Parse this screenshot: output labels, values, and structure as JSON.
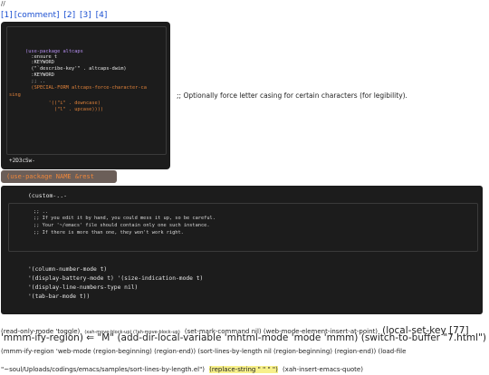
{
  "page": {
    "top_slashes": "//",
    "footnotes": [
      "[1]",
      "[comment]",
      "[2]",
      "[3]",
      "[4]"
    ]
  },
  "panel1": {
    "lines": [
      {
        "text": "(use-package altcaps",
        "cls": "c-purple"
      },
      {
        "text": "  :ensure t",
        "cls": "c-white"
      },
      {
        "text": "  :KEYWORD",
        "cls": "c-white"
      },
      {
        "text": "  (\"`describe-key'\" . altcaps-dwim)",
        "cls": "c-white"
      },
      {
        "text": "  :KEYWORD",
        "cls": "c-white"
      },
      {
        "text": "  ;; ..",
        "cls": "c-dim"
      },
      {
        "text": "  (SPECIAL-FORM altcaps-force-character-ca",
        "cls": "c-orange"
      },
      {
        "text": "sing",
        "cls": "c-orange"
      },
      {
        "text": "        '((\"i\" . downcase)",
        "cls": "c-orange"
      },
      {
        "text": "          (\"l\" . upcase))))",
        "cls": "c-orange"
      }
    ],
    "footer": "+2D3cSw-"
  },
  "side_comment": ";; Optionally force letter casing for certain characters (for legibility).",
  "usepkg_label": "(use-package NAME &rest ARGS)",
  "panel2": {
    "head": "(custom-..-",
    "comment_lines": [
      ";; ..",
      ";; If you edit it by hand, you could mess it up, so be careful.",
      ";; Your '~/emacs' file should contain only one such instance.",
      ";; If there is more than one, they won't work right."
    ],
    "code_lines": [
      "'(column-number-mode t)",
      "'(display-battery-mode t) '(size-indication-mode t)",
      "'(display-line-numbers-type nil)",
      "'(tab-bar-mode t))"
    ]
  },
  "bottom": {
    "l1_a": "(read-only-mode 'toggle)",
    "l1_b": "(xah-move-block-up) (?ah-move-block-up)",
    "l1_c": "(set-mark-command nil) (web-mode-element-insert-at-point)",
    "l1_d": "(local-set-key [77]",
    "l2": "'mmm-ify-region) ⇐ \"M\" (add-dir-local-variable 'mhtml-mode 'mode 'mmm) (switch-to-buffer \"7.html\")",
    "l3": "(mmm-ify-region 'web-mode (region-beginning) (region-end)) (sort-lines-by-length nil (region-beginning) (region-end)) (load-file",
    "l4_a": "\"~soul/Uploads/codings/emacs/samples/sort-lines-by-length.el\")",
    "l4_b": "(replace-string \" \" \" \")",
    "l4_c": "(xah-insert-emacs-quote)"
  }
}
